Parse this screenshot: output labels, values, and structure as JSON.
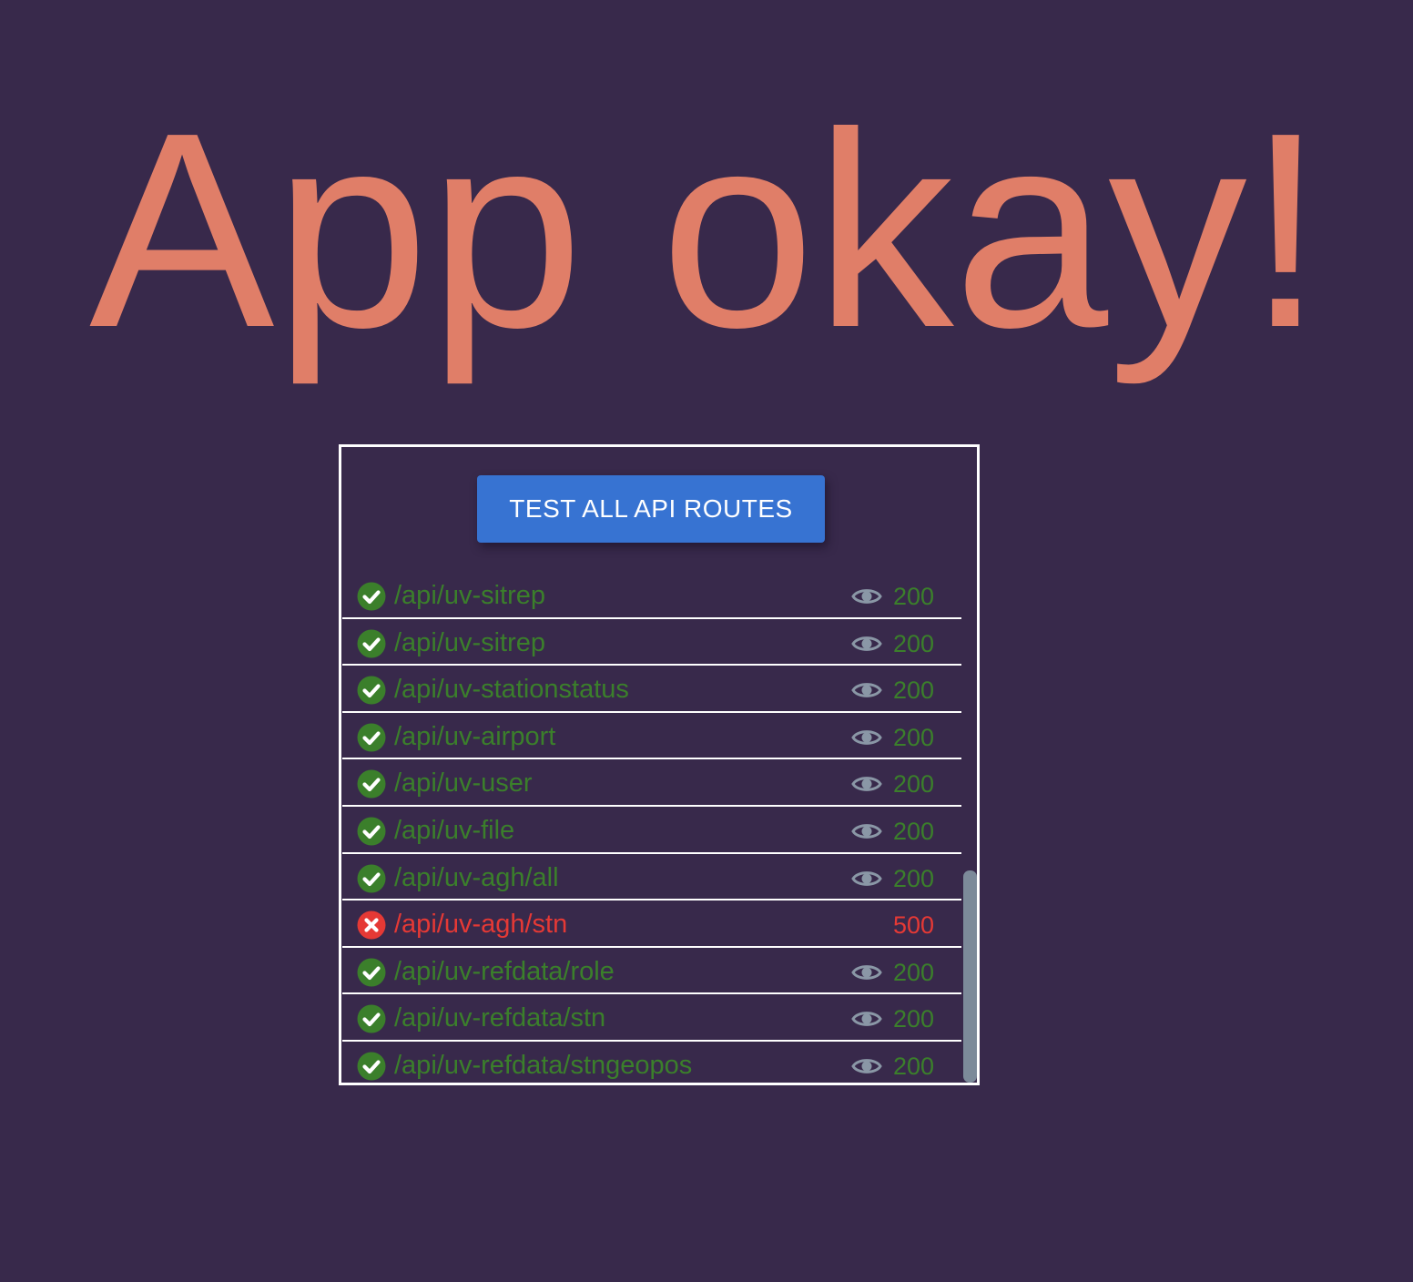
{
  "title": "App okay!",
  "panel": {
    "button_label": "TEST ALL API ROUTES",
    "colors": {
      "ok": "#3b7f2b",
      "error": "#e53935",
      "button": "#3773d2",
      "title": "#e07e68",
      "background": "#38294b"
    },
    "routes": [
      {
        "path": "/api/uv-sitrep",
        "status": "200",
        "ok": true
      },
      {
        "path": "/api/uv-sitrep",
        "status": "200",
        "ok": true
      },
      {
        "path": "/api/uv-stationstatus",
        "status": "200",
        "ok": true
      },
      {
        "path": "/api/uv-airport",
        "status": "200",
        "ok": true
      },
      {
        "path": "/api/uv-user",
        "status": "200",
        "ok": true
      },
      {
        "path": "/api/uv-file",
        "status": "200",
        "ok": true
      },
      {
        "path": "/api/uv-agh/all",
        "status": "200",
        "ok": true
      },
      {
        "path": "/api/uv-agh/stn",
        "status": "500",
        "ok": false
      },
      {
        "path": "/api/uv-refdata/role",
        "status": "200",
        "ok": true
      },
      {
        "path": "/api/uv-refdata/stn",
        "status": "200",
        "ok": true
      },
      {
        "path": "/api/uv-refdata/stngeopos",
        "status": "200",
        "ok": true
      }
    ]
  }
}
